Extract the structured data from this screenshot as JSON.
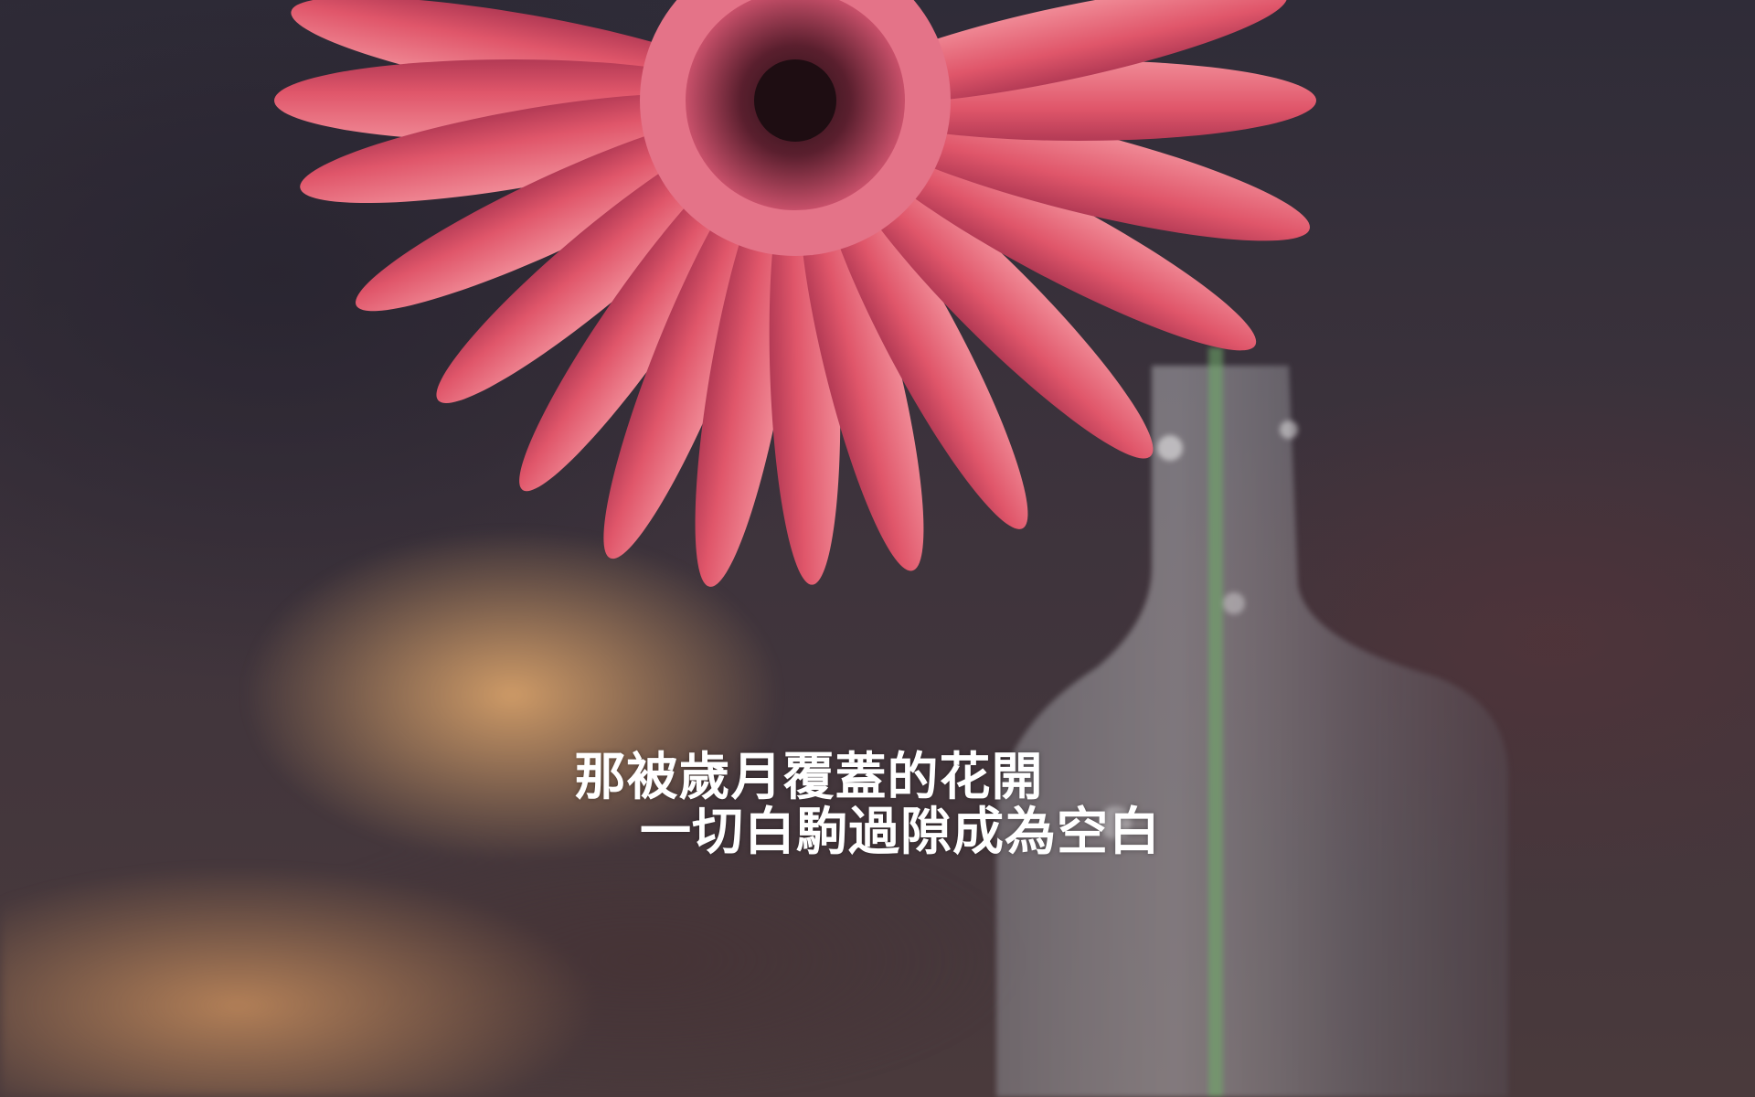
{
  "caption": {
    "line1": "那被歲月覆蓋的花開",
    "line2": "一切白駒過隙成為空白"
  },
  "colors": {
    "petal": "#e0566a",
    "petal_highlight": "#f3a3ac",
    "flower_center": "#5a1f2e",
    "background_dark": "#2f2c38",
    "wood_glow": "#d6a069",
    "stem": "#6fae6a",
    "caption_text": "#ffffff"
  }
}
